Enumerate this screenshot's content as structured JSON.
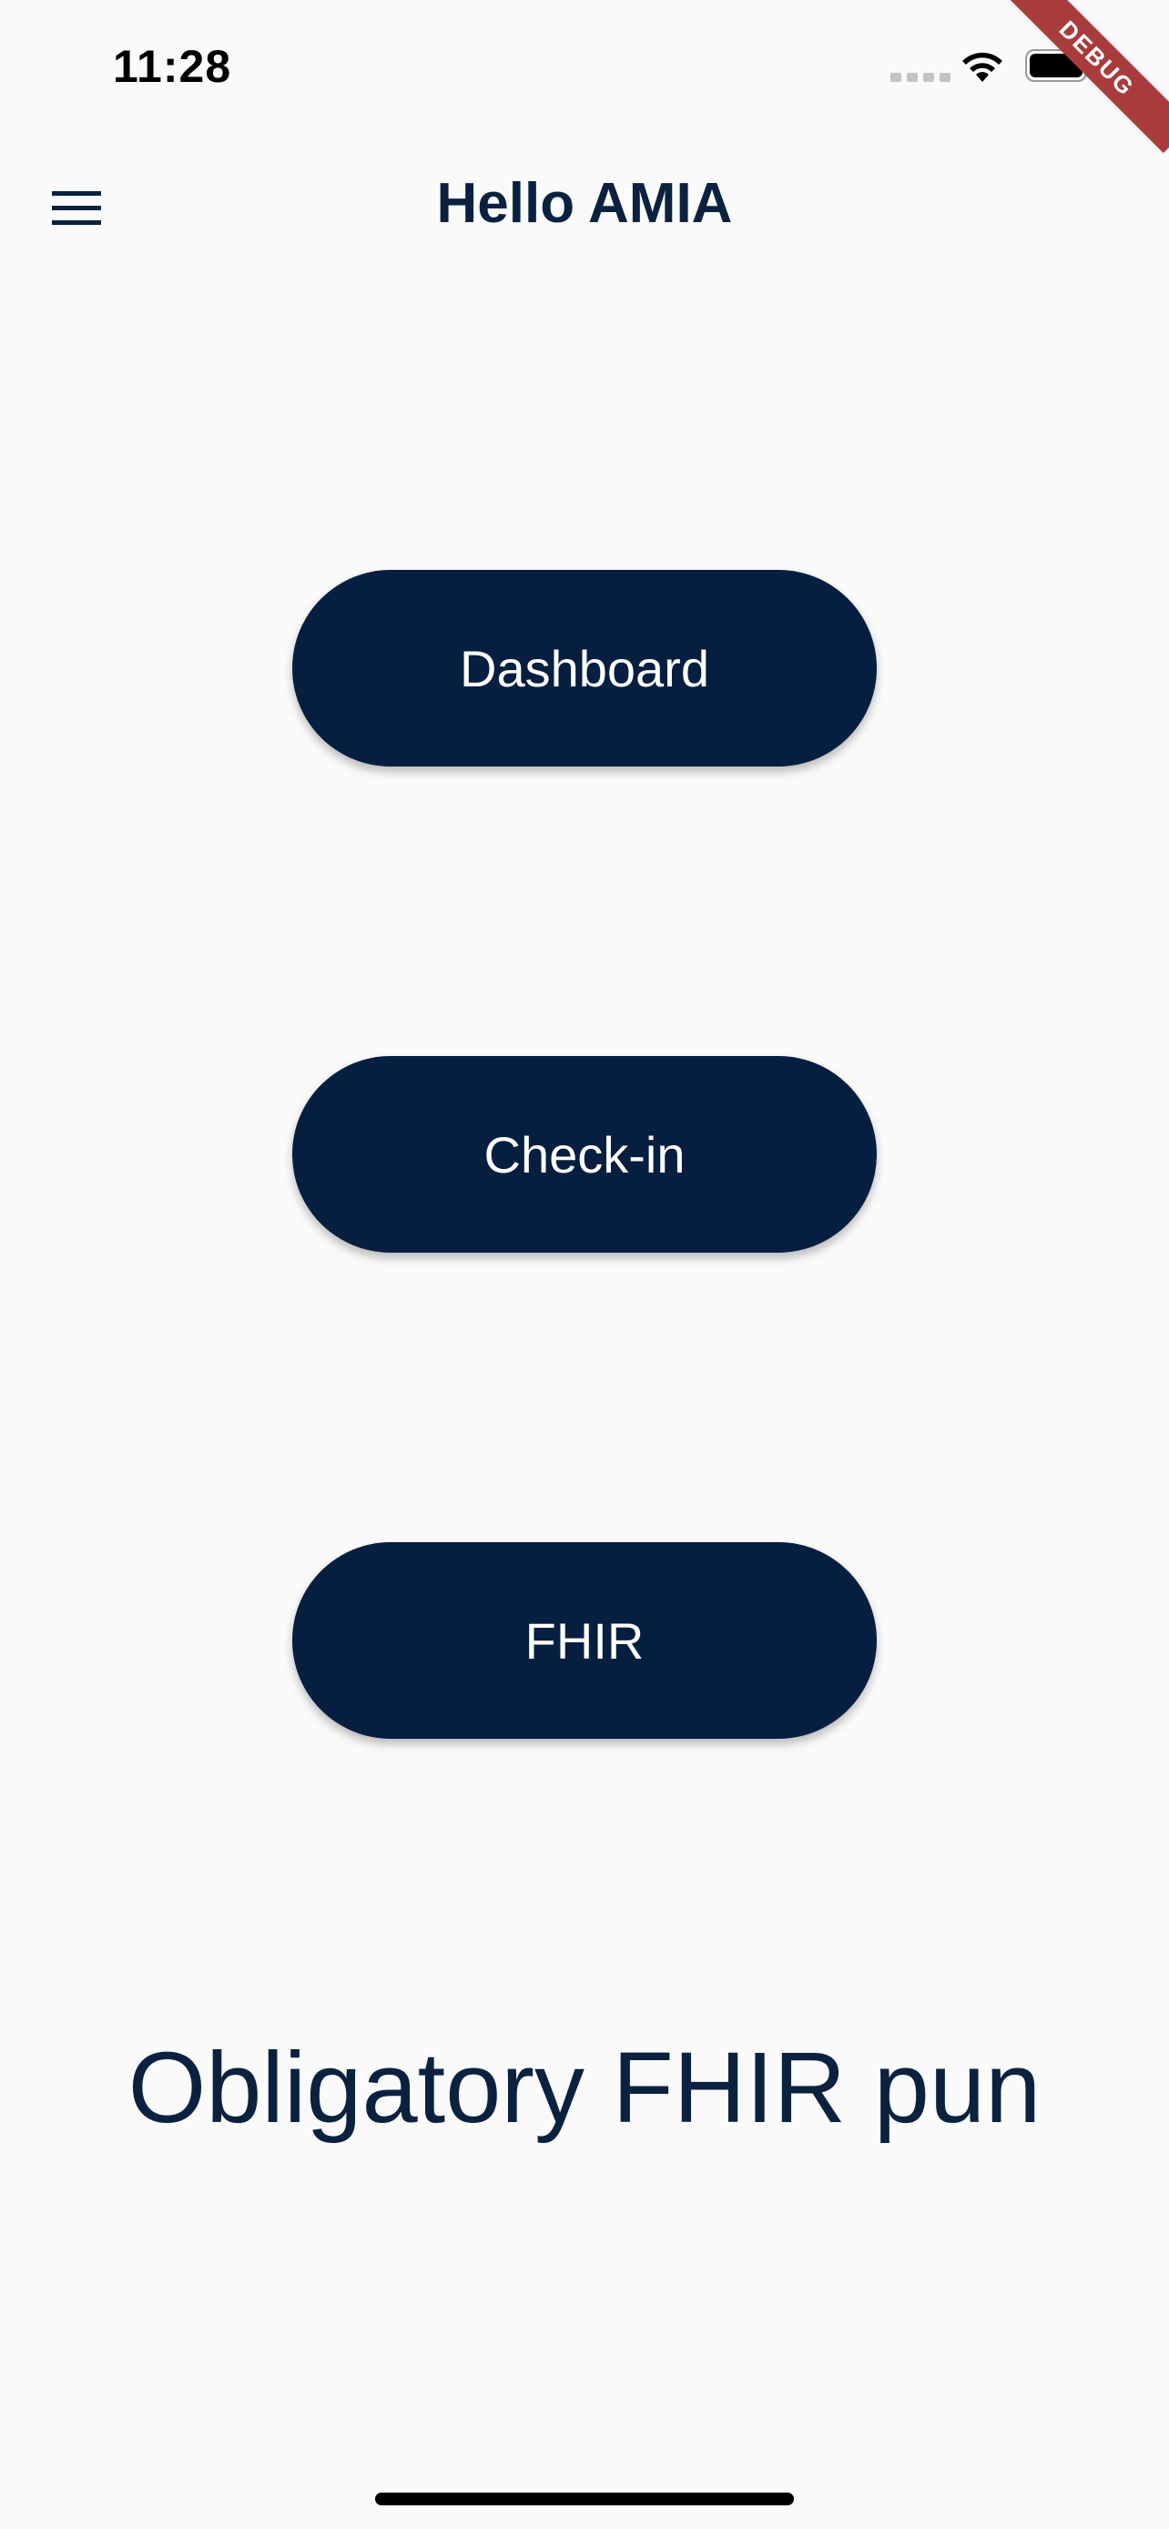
{
  "status_bar": {
    "time": "11:28",
    "wifi_icon": "wifi-icon",
    "battery_icon": "battery-icon",
    "signal_icon": "cellular-signal-dots"
  },
  "debug_banner": {
    "label": "DEBUG",
    "color": "#a83c3c"
  },
  "app_bar": {
    "title": "Hello AMIA",
    "menu_icon": "hamburger-menu-icon"
  },
  "buttons": [
    {
      "label": "Dashboard"
    },
    {
      "label": "Check-in"
    },
    {
      "label": "FHIR"
    }
  ],
  "footer": {
    "pun": "Obligatory FHIR pun"
  },
  "colors": {
    "background": "#fafafa",
    "primary": "#061f40",
    "text": "#0a2240",
    "button_text": "#ffffff"
  }
}
